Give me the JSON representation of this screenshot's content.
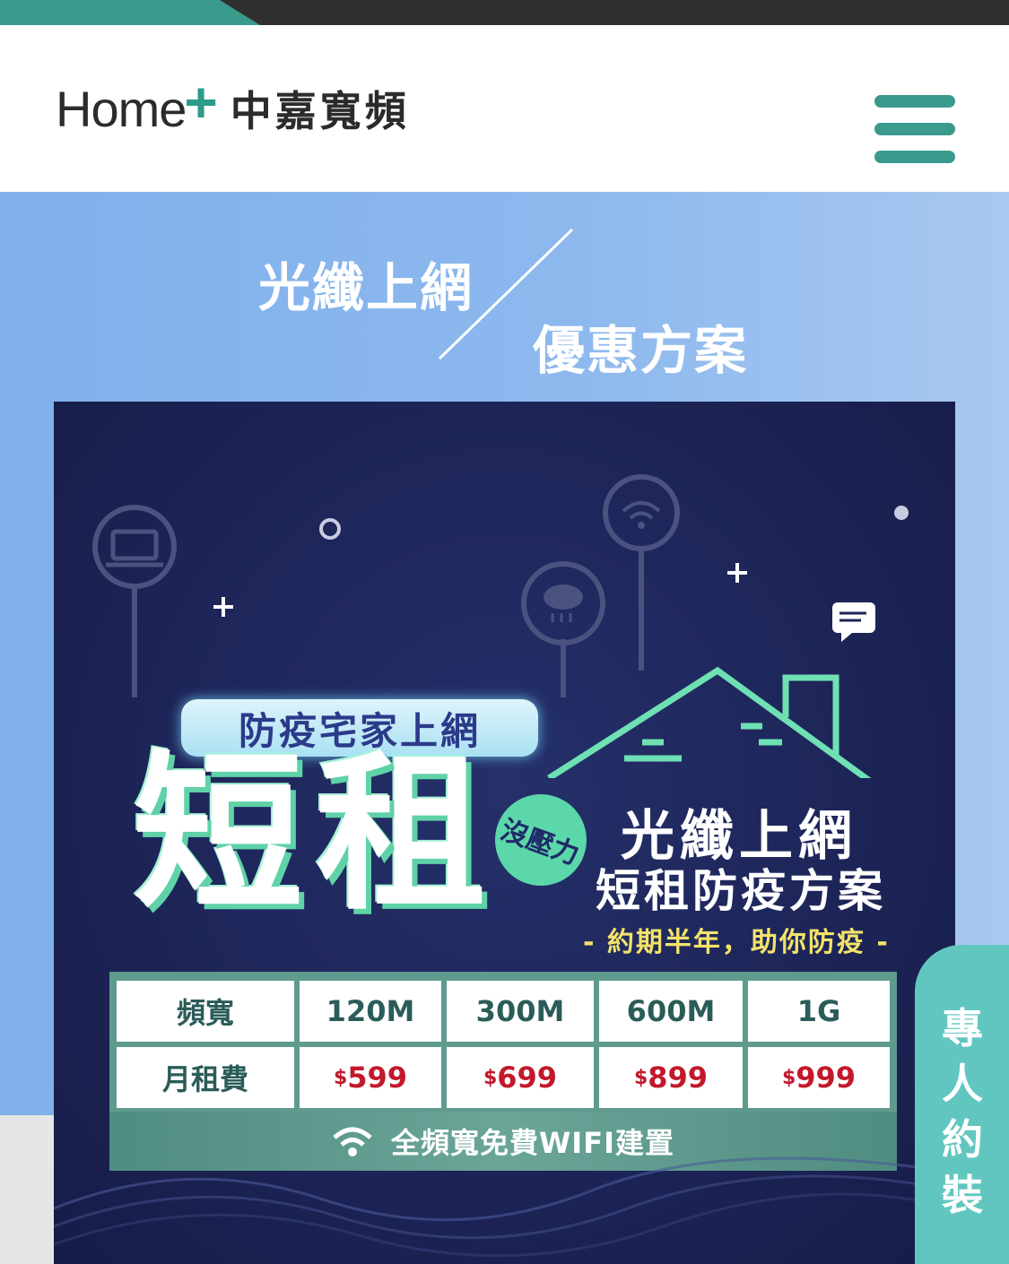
{
  "brand": {
    "logo_en": "Home",
    "logo_plus": "+",
    "logo_zh": "中嘉寬頻"
  },
  "hero": {
    "left": "光纖上網",
    "right": "優惠方案"
  },
  "banner": {
    "tag": "防疫宅家上網",
    "big": "短租",
    "badge": "沒壓力",
    "title1": "光纖上網",
    "title2": "短租防疫方案",
    "subtitle": "- 約期半年，助你防疫 -",
    "table": {
      "headers": [
        "頻寬",
        "120M",
        "300M",
        "600M",
        "1G"
      ],
      "row_label": "月租費",
      "currency": "$",
      "prices": [
        "599",
        "699",
        "899",
        "999"
      ]
    },
    "wifi_note": "全頻寬免費WIFI建置"
  },
  "side_tab": {
    "chars": [
      "專",
      "人",
      "約",
      "裝"
    ]
  },
  "colors": {
    "accent": "#3a9a8c",
    "hero_bg": "#8cb8ee",
    "banner_bg": "#1d2558",
    "price": "#c3182b",
    "side_tab": "#62c6c0"
  },
  "icons": [
    "menu-icon",
    "laptop-icon",
    "wifi-icon",
    "cloud-rain-icon",
    "chat-icon",
    "house-icon"
  ]
}
